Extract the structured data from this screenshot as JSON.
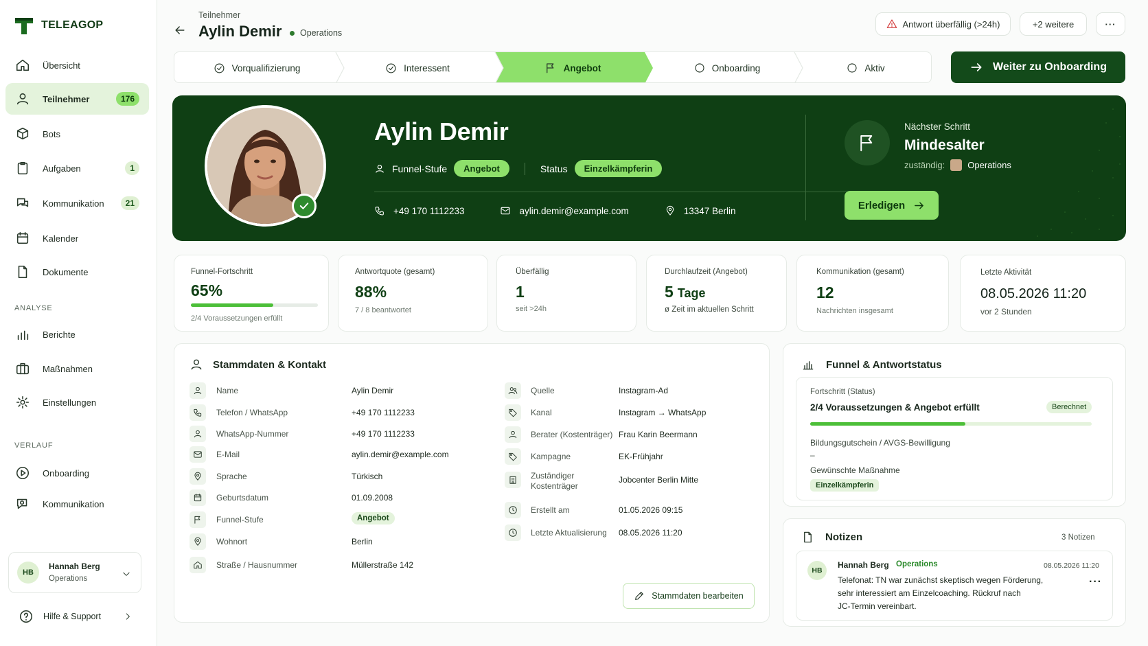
{
  "brand": {
    "name": "TELEAGOP"
  },
  "sidebar": {
    "items": [
      {
        "label": "Übersicht",
        "icon": "home-icon"
      },
      {
        "label": "Teilnehmer",
        "icon": "user-icon",
        "badge": "176"
      },
      {
        "label": "Bots",
        "icon": "cube-icon"
      },
      {
        "label": "Aufgaben",
        "icon": "clipboard-icon",
        "badge": "1"
      },
      {
        "label": "Kommunikation",
        "icon": "chat-icon",
        "badge": "21"
      },
      {
        "label": "Kalender",
        "icon": "calendar-icon"
      },
      {
        "label": "Dokumente",
        "icon": "document-icon"
      }
    ],
    "section_analyse": "ANALYSE",
    "analyse_items": [
      {
        "label": "Berichte"
      },
      {
        "label": "Maßnahmen"
      },
      {
        "label": "Einstellungen"
      }
    ],
    "section_verlauf": "VERLAUF",
    "verlauf_items": [
      {
        "label": "Onboarding"
      },
      {
        "label": "Kommunikation"
      }
    ],
    "user": {
      "initials": "HB",
      "name": "Hannah Berg",
      "role": "Operations"
    },
    "help": "Hilfe & Support"
  },
  "header": {
    "breadcrumb": "Teilnehmer",
    "title": "Aylin Demir",
    "team": "Operations",
    "alert": "Antwort überfällig (>24h)",
    "more": "+2 weitere",
    "menu": "···"
  },
  "stepper": {
    "steps": [
      "Vorqualifizierung",
      "Interessent",
      "Angebot",
      "Onboarding",
      "Aktiv"
    ],
    "next_button": "Weiter zu Onboarding"
  },
  "hero": {
    "name": "Aylin Demir",
    "funnel_label": "Funnel-Stufe",
    "funnel_value": "Angebot",
    "status_label": "Status",
    "status_value": "Einzelkämpferin",
    "phone": "+49 170 1112233",
    "email": "aylin.demir@example.com",
    "location": "13347 Berlin",
    "next_label": "Nächster Schritt",
    "next_title": "Mindesalter",
    "owner_label": "zuständig:",
    "owner_value": "Operations",
    "action": "Erledigen"
  },
  "stats": [
    {
      "label": "Funnel-Fortschritt",
      "value": "65%",
      "sub": "2/4 Voraussetzungen erfüllt",
      "progress": 0.65
    },
    {
      "label": "Antwortquote (gesamt)",
      "value": "88%",
      "sub": "7 / 8 beantwortet"
    },
    {
      "label": "Überfällig",
      "value": "1",
      "sub": "seit >24h"
    },
    {
      "label": "Durchlaufzeit (Angebot)",
      "value_num": "5",
      "value_unit": "Tage",
      "sub": "ø Zeit im aktuellen Schritt"
    },
    {
      "label": "Kommunikation (gesamt)",
      "value": "12",
      "sub": "Nachrichten insgesamt"
    },
    {
      "label": "Letzte Aktivität",
      "value": "08.05.2026 11:20",
      "sub": "vor 2 Stunden"
    }
  ],
  "stammdaten": {
    "title": "Stammdaten & Kontakt",
    "left": [
      {
        "label": "Name",
        "value": "Aylin Demir"
      },
      {
        "label": "Telefon / WhatsApp",
        "value": "+49 170 1112233"
      },
      {
        "label": "WhatsApp-Nummer",
        "value": "+49 170 1112233"
      },
      {
        "label": "E-Mail",
        "value": "aylin.demir@example.com"
      },
      {
        "label": "Sprache",
        "value": "Türkisch"
      },
      {
        "label": "Geburtsdatum",
        "value": "01.09.2008"
      },
      {
        "label": "Funnel-Stufe",
        "value": "Angebot"
      },
      {
        "label": "Wohnort",
        "value": "Berlin"
      },
      {
        "label": "Straße / Hausnummer",
        "value": "Müllerstraße 142"
      }
    ],
    "right": [
      {
        "label": "Quelle",
        "value": "Instagram-Ad"
      },
      {
        "label": "Kanal",
        "value": "Instagram → WhatsApp"
      },
      {
        "label": "Berater (Kostenträger)",
        "value": "Frau Karin Beermann"
      },
      {
        "label": "Kampagne",
        "value": "EK-Frühjahr"
      },
      {
        "label": "Zuständiger Kostenträger",
        "value": "Jobcenter Berlin Mitte"
      },
      {
        "label": "Erstellt am",
        "value": "01.05.2026 09:15"
      },
      {
        "label": "Letzte Aktualisierung",
        "value": "08.05.2026 11:20"
      }
    ],
    "edit_button": "Stammdaten bearbeiten"
  },
  "funnel": {
    "title": "Funnel & Antwortstatus",
    "progress_label": "Fortschritt (Status)",
    "progress_text": "2/4 Voraussetzungen & Angebot erfüllt",
    "progress_badge": "Berechnet",
    "progress": 0.55,
    "bildung_label": "Bildungsgutschein / AVGS-Bewilligung",
    "bildung_value": "–",
    "massnahme_label": "Gewünschte Maßnahme",
    "massnahme_value": "Einzelkämpferin"
  },
  "notes": {
    "title": "Notizen",
    "count": "3 Notizen",
    "items": [
      {
        "initials": "HB",
        "author": "Hannah Berg",
        "team": "Operations",
        "time": "08.05.2026 11:20",
        "line1": "Telefonat: TN war zunächst skeptisch wegen Förderung,",
        "line2": "sehr interessiert am Einzelcoaching. Rückruf nach",
        "line3": "JC-Termin vereinbart."
      }
    ]
  },
  "colors": {
    "primary": "#0f3f14",
    "accent": "#8ee06b",
    "soft": "#e4f3dc"
  }
}
